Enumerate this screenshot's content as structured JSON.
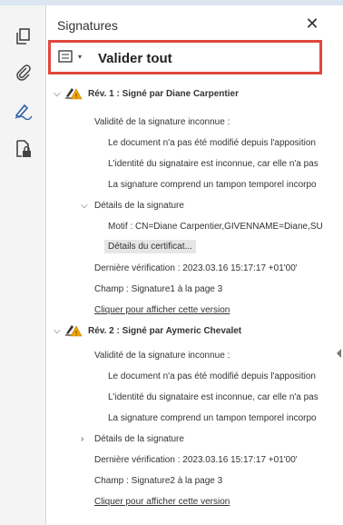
{
  "panel": {
    "title": "Signatures",
    "close_symbol": "✕"
  },
  "toolbar": {
    "validate_all_label": "Valider tout"
  },
  "rev1": {
    "title": "Rév. 1 : Signé par Diane Carpentier",
    "validity": "Validité de la signature inconnue :",
    "line1": "Le document n'a pas été modifié depuis l'apposition",
    "line2": "L'identité du signataire est inconnue, car elle n'a pas",
    "line3": "La signature comprend un tampon temporel incorpo",
    "details_label": "Détails de la signature",
    "motif": "Motif : CN=Diane Carpentier,GIVENNAME=Diane,SU",
    "cert_details": "Détails du certificat...",
    "last_check": "Dernière vérification : 2023.03.16 15:17:17 +01'00'",
    "field": "Champ : Signature1 à la page 3",
    "show_version": "Cliquer pour afficher cette version"
  },
  "rev2": {
    "title": "Rév. 2 : Signé par Aymeric Chevalet",
    "validity": "Validité de la signature inconnue :",
    "line1": "Le document n'a pas été modifié depuis l'apposition",
    "line2": "L'identité du signataire est inconnue, car elle n'a pas",
    "line3": "La signature comprend un tampon temporel incorpo",
    "details_label": "Détails de la signature",
    "last_check": "Dernière vérification : 2023.03.16 15:17:17 +01'00'",
    "field": "Champ : Signature2 à la page 3",
    "show_version": "Cliquer pour afficher cette version"
  },
  "icons": {
    "rail": [
      "pages-icon",
      "attachment-icon",
      "signature-pen-icon",
      "document-lock-icon"
    ],
    "signature_status": "signature-warning-icon",
    "expanded_chevron": "chevron-down-icon",
    "collapsed_chevron": "chevron-right-icon"
  },
  "colors": {
    "accent_border": "#e0473c",
    "warning": "#f2a600",
    "active_tool": "#2b5fa8"
  }
}
